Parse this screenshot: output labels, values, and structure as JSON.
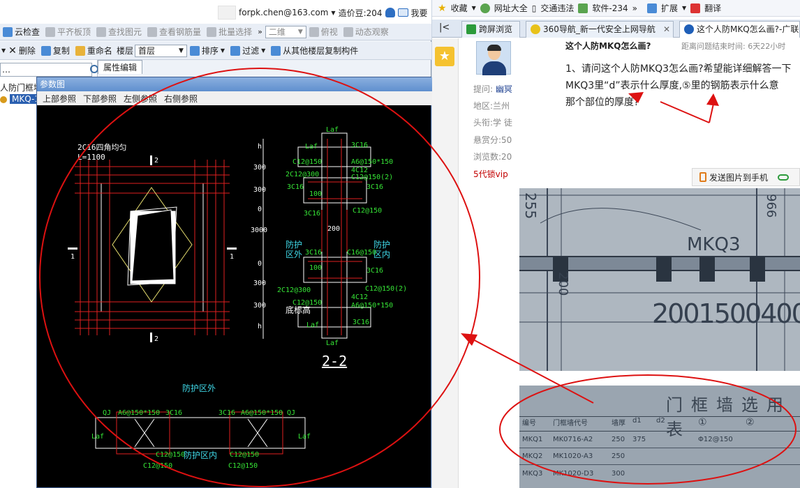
{
  "cad": {
    "account_email": "forpk.chen@163.com",
    "price_label": "造价豆:204",
    "want_label": "我要",
    "toolbar1": [
      "云检查",
      "平齐板顶",
      "查找图元",
      "查看钢筋量",
      "批量选择",
      "二维",
      "俯视",
      "动态观察"
    ],
    "toolbar2": {
      "delete": "删除",
      "copy": "复制",
      "rename": "重命名",
      "floor_label": "楼层",
      "floor_value": "首层",
      "sort": "排序",
      "filter": "过滤",
      "copy_from": "从其他楼层复制构件"
    },
    "tree": {
      "search_placeholder": "…",
      "item1": "人防门框墙",
      "item2": "MKQ-1"
    },
    "prop_tab": "属性编辑",
    "dialog": {
      "title": "参数图",
      "menu": [
        "上部参照",
        "下部参照",
        "左侧参照",
        "右侧参照"
      ],
      "drawing": {
        "corner_note": "2C16四角均匀",
        "corner_len": "L=1100",
        "sec_mark": "2",
        "sec_mark_side": "1",
        "dims": [
          "h",
          "300",
          "300",
          "0",
          "3000",
          "0",
          "300",
          "300",
          "h"
        ],
        "laf": "Laf",
        "labels": [
          "3C16",
          "C12@150",
          "A6@150*150",
          "2C12@300",
          "4C12",
          "C12@150(2)",
          "100",
          "200",
          "C16@150"
        ],
        "protect_out": "防护\n区外",
        "protect_in": "防护\n区内",
        "bottom_elev": "底标高",
        "section_title": "2-2",
        "plan_protect_out": "防护区外",
        "plan_protect_in": "防护区内",
        "plan_labels": [
          "QJ",
          "A6@150*150",
          "3C16",
          "C12@150"
        ]
      }
    }
  },
  "browser": {
    "toolbar": [
      "收藏",
      "网址大全",
      "交通违法",
      "软件-234",
      "扩展",
      "翻译"
    ],
    "tabs": [
      {
        "label": "跨屏浏览"
      },
      {
        "label": "360导航_新一代安全上网导航"
      },
      {
        "label": "这个人防MKQ怎么画?-广联"
      }
    ],
    "question": {
      "title": "这个人防MKQ怎么画?",
      "meta": "距离问题结束时间: 6天22小时",
      "body": "1、请问这个人防MKQ3怎么画?希望能详细解答一下\nMKQ3里“d”表示什么厚度,⑤里的钢筋表示什么意\n那个部位的厚度?"
    },
    "asker": {
      "asker_label": "提问:",
      "asker_name": "幽冥",
      "region": "地区:兰州",
      "rank": "头衔:学 徒",
      "reward": "悬赏分:50",
      "views": "浏览数:20",
      "vip": "5代锁vip"
    },
    "share_label": "发送图片到手机",
    "photo1": {
      "label": "MKQ3",
      "dims": "2001500400",
      "scale_marks": [
        "255",
        "200",
        "966"
      ]
    },
    "photo2": {
      "title": "门框墙选用表",
      "headers": [
        "编号",
        "门框墙代号",
        "墙厚",
        "d1",
        "d2",
        "①",
        "②"
      ],
      "rows": [
        [
          "MKQ1",
          "MK0716-A2",
          "250",
          "375",
          "",
          "Φ12@150",
          ""
        ],
        [
          "MKQ2",
          "MK1020-A3",
          "250",
          "",
          "",
          "",
          ""
        ],
        [
          "MKQ3",
          "MK1020-D3",
          "300",
          "",
          "",
          "",
          ""
        ]
      ]
    }
  },
  "colors": {
    "annotation": "#dd1111",
    "cad_green": "#36e636",
    "cad_red": "#e02020",
    "cad_cyan": "#3fd7e6",
    "cad_white": "#ffffff"
  }
}
